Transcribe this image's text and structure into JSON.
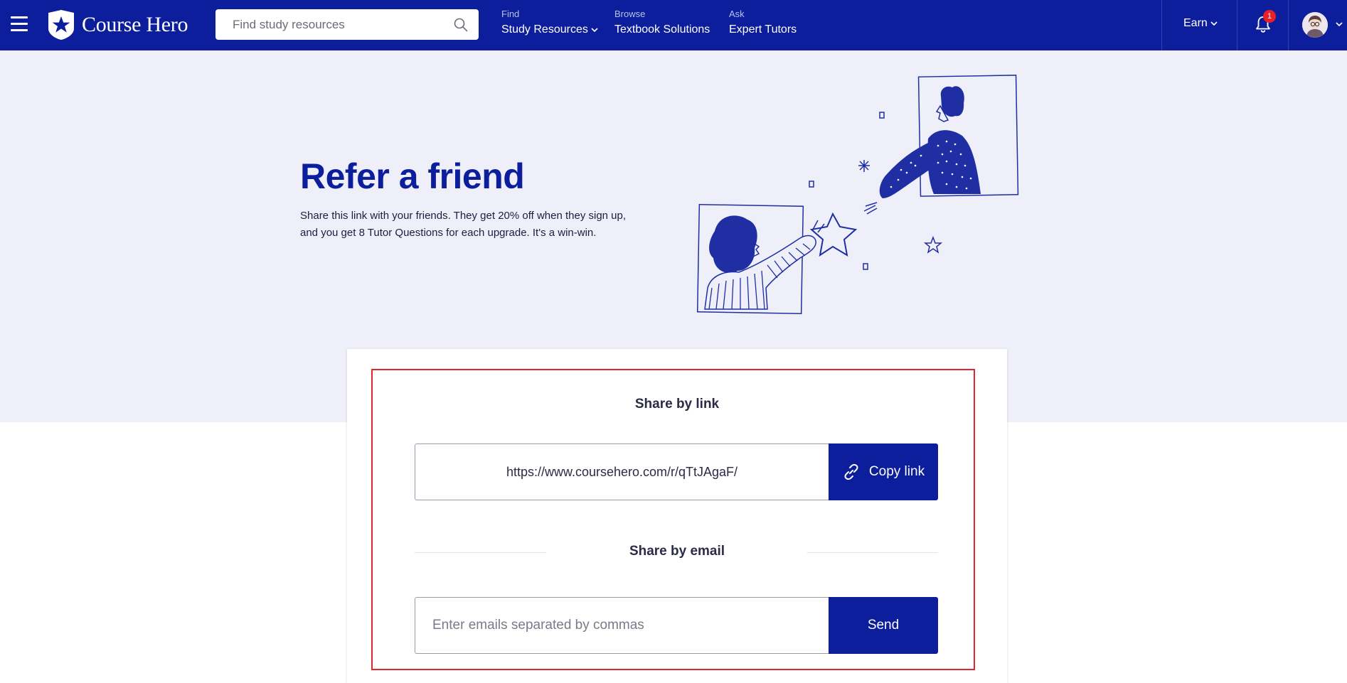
{
  "nav": {
    "brand": "Course Hero",
    "search_placeholder": "Find study resources",
    "groups": [
      {
        "small": "Find",
        "label": "Study Resources"
      },
      {
        "small": "Browse",
        "label": "Textbook Solutions"
      },
      {
        "small": "Ask",
        "label": "Expert Tutors"
      }
    ],
    "earn_label": "Earn",
    "notification_count": "1"
  },
  "hero": {
    "title": "Refer a friend",
    "description": "Share this link with your friends. They get 20% off when they sign up, and you get 8 Tutor Questions for each upgrade. It's a win-win."
  },
  "share_link": {
    "heading": "Share by link",
    "url": "https://www.coursehero.com/r/qTtJAgaF/",
    "button_label": "Copy link"
  },
  "share_email": {
    "heading": "Share by email",
    "placeholder": "Enter emails separated by commas",
    "button_label": "Send"
  },
  "colors": {
    "brand_navy": "#0c1e9c",
    "hero_background": "#eeeff9",
    "highlight_red": "#e0262c",
    "badge_red": "#e8202a"
  }
}
